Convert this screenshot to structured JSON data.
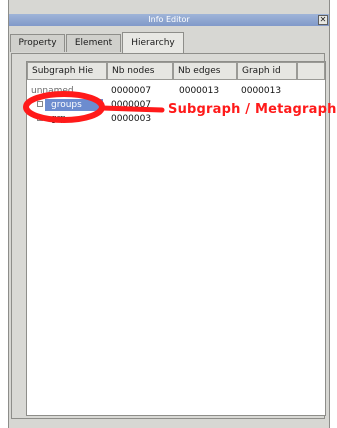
{
  "window": {
    "title": "Info Editor",
    "close_glyph": "✕"
  },
  "tabs": [
    {
      "label": "Property"
    },
    {
      "label": "Element"
    },
    {
      "label": "Hierarchy"
    }
  ],
  "active_tab": "Hierarchy",
  "table": {
    "columns": [
      "Subgraph Hie",
      "Nb nodes",
      "Nb edges",
      "Graph id"
    ],
    "rows": [
      {
        "name": "unnamed",
        "nb_nodes": "0000007",
        "nb_edges": "0000013",
        "graph_id": "0000013"
      },
      {
        "name": "groups",
        "nb_nodes": "0000007",
        "nb_edges": "",
        "graph_id": ""
      },
      {
        "name": "grp",
        "nb_nodes": "0000003",
        "nb_edges": "",
        "graph_id": ""
      }
    ],
    "selected_row": "groups"
  },
  "annotation": {
    "label": "Subgraph / Metagraph",
    "color": "#ff1a1a"
  }
}
